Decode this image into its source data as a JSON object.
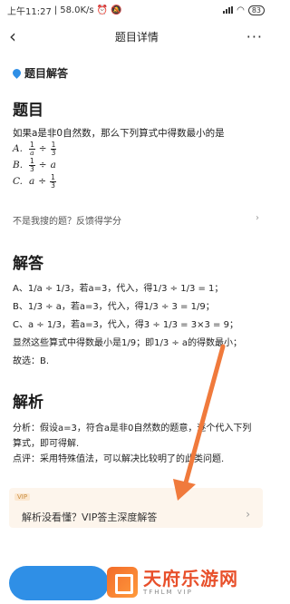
{
  "status_bar": {
    "time": "上午11:27",
    "speed": "58.0K/s",
    "battery": "83"
  },
  "nav": {
    "title": "题目详情",
    "more": "···"
  },
  "tag": {
    "label": "题目解答"
  },
  "question": {
    "heading": "题目",
    "text": "如果a是非0自然数，那么下列算式中得数最小的是",
    "options": [
      {
        "letter": "A.",
        "parts": [
          "1",
          "a",
          "÷",
          "1",
          "3"
        ]
      },
      {
        "letter": "B.",
        "parts": [
          "1",
          "3",
          "÷",
          "a"
        ]
      },
      {
        "letter": "C.",
        "parts": [
          "a",
          "÷",
          "1",
          "3"
        ]
      }
    ]
  },
  "feedback": {
    "label": "不是我搜的题？反馈得学分"
  },
  "answer": {
    "heading": "解答",
    "line_a": "A、1/a ÷ 1/3，若a=3，代入，得1/3 ÷ 1/3 = 1；",
    "line_b": "B、1/3 ÷ a，若a=3，代入，得1/3 ÷ 3 = 1/9；",
    "line_c": "C、a ÷ 1/3，若a=3，代入，得3 ÷ 1/3 = 3×3 = 9；",
    "line_d": "显然这些算式中得数最小是1/9；即1/3 ÷ a的得数最小；",
    "line_e": "故选：B."
  },
  "analysis": {
    "heading": "解析",
    "text1": "分析：假设a=3，符合a是非0自然数的题意，逐个代入下列算式，即可得解.",
    "text2": "点评：采用特殊值法，可以解决比较明了的此类问题."
  },
  "vip": {
    "badge": "VIP",
    "text": "解析没看懂？VIP答主深度解答"
  },
  "watermark": {
    "cn": "天府乐游网",
    "en": "TFHLM VIP"
  },
  "colors": {
    "accent": "#2f8fe6",
    "arrow": "#f07a3c",
    "vip_bg": "#fdf5ec"
  }
}
